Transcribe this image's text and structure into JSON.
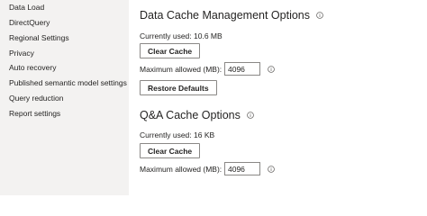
{
  "sidebar": {
    "items": [
      {
        "label": "Data Load"
      },
      {
        "label": "DirectQuery"
      },
      {
        "label": "Regional Settings"
      },
      {
        "label": "Privacy"
      },
      {
        "label": "Auto recovery"
      },
      {
        "label": "Published semantic model settings"
      },
      {
        "label": "Query reduction"
      },
      {
        "label": "Report settings"
      }
    ]
  },
  "data_cache": {
    "title": "Data Cache Management Options",
    "currently_used": "Currently used: 10.6 MB",
    "clear_label": "Clear Cache",
    "max_label": "Maximum allowed (MB):",
    "max_value": "4096",
    "restore_label": "Restore Defaults"
  },
  "qa_cache": {
    "title": "Q&A Cache Options",
    "currently_used": "Currently used: 16 KB",
    "clear_label": "Clear Cache",
    "max_label": "Maximum allowed (MB):",
    "max_value": "4096"
  },
  "icons": {
    "info": "info-icon"
  }
}
